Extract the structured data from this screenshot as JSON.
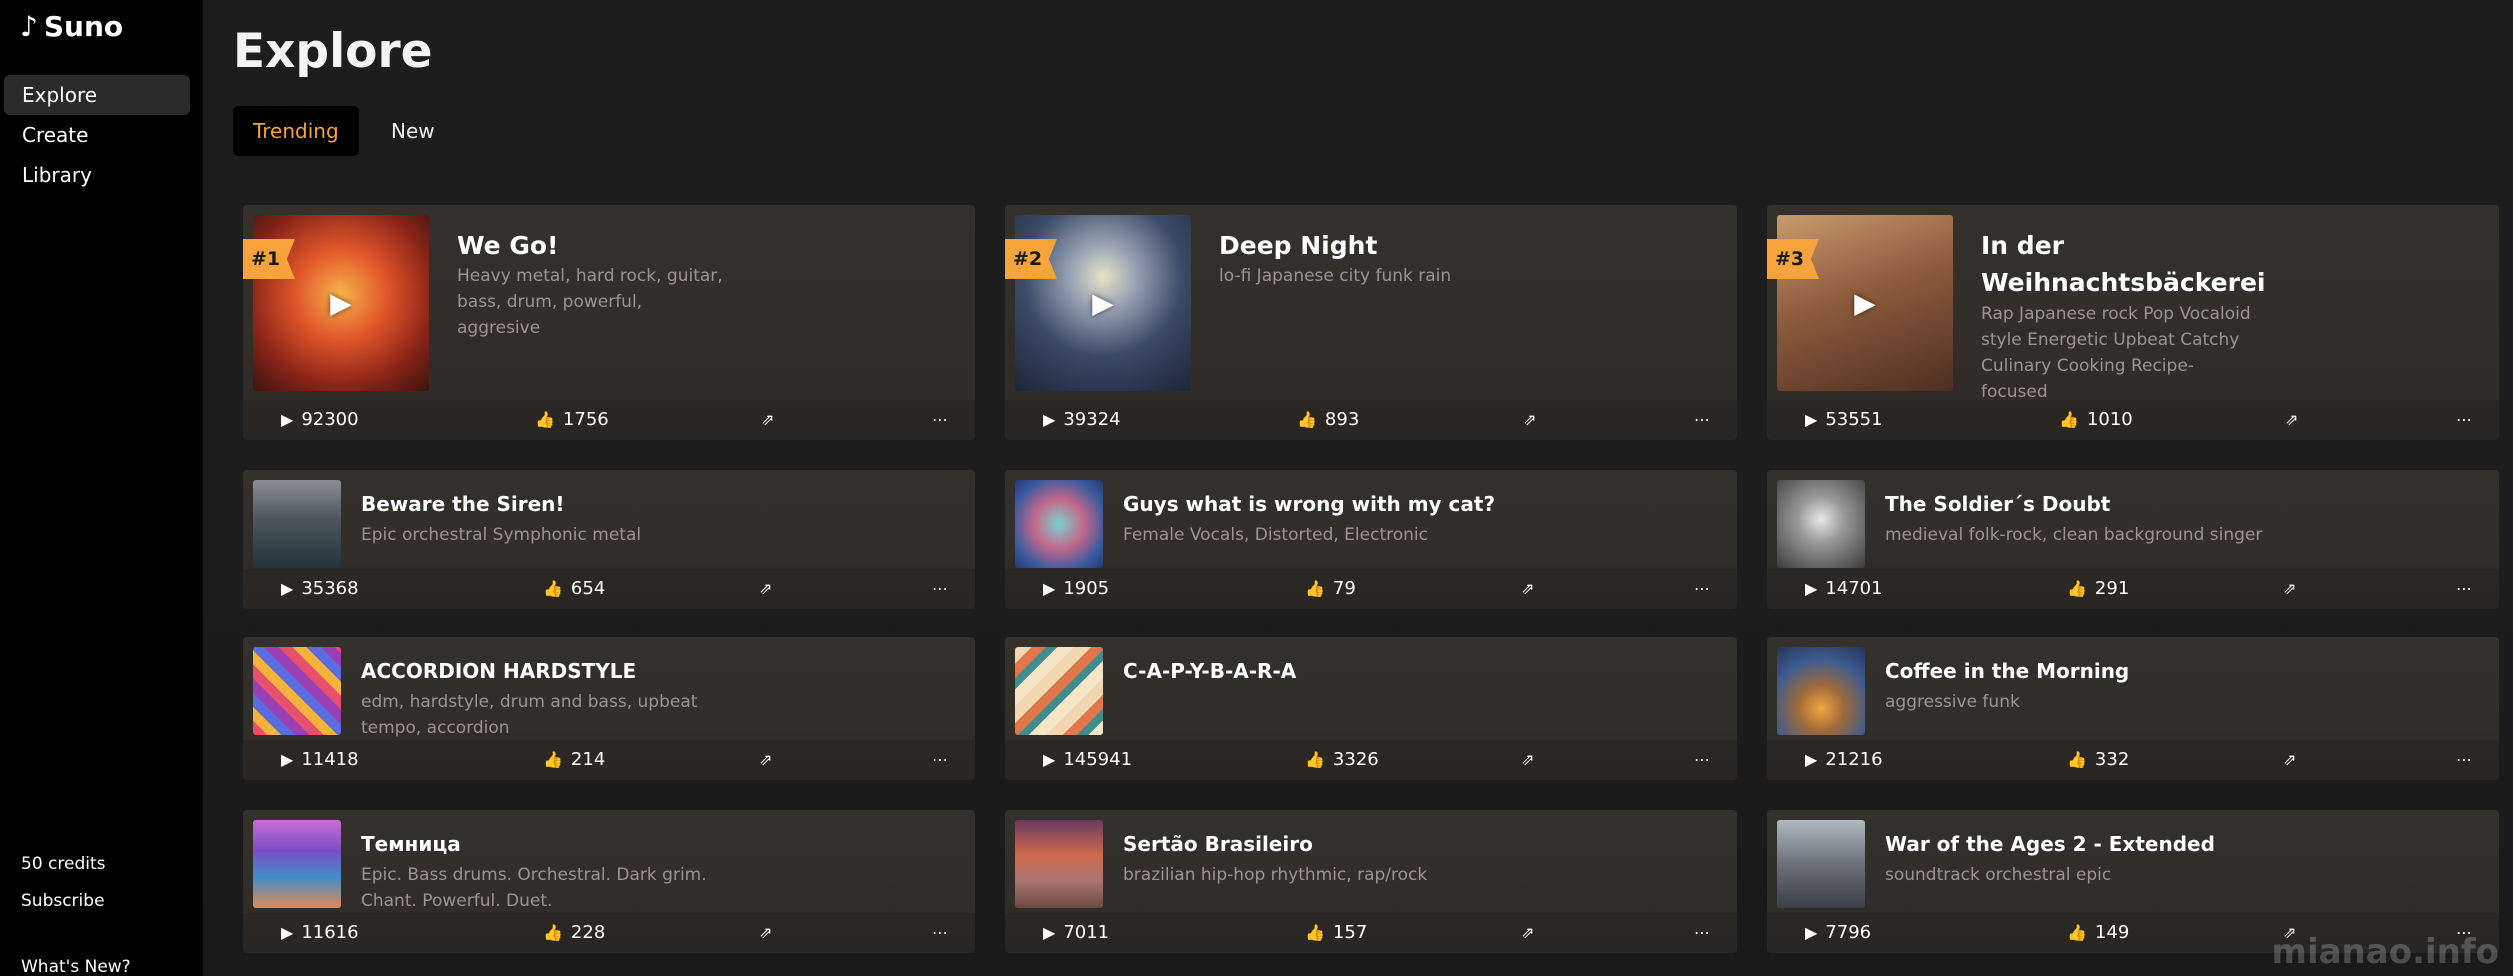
{
  "app": {
    "name": "Suno",
    "logo_glyph": "♪"
  },
  "sidebar": {
    "items": [
      {
        "label": "Explore",
        "active": true
      },
      {
        "label": "Create",
        "active": false
      },
      {
        "label": "Library",
        "active": false
      }
    ],
    "credits": "50 credits",
    "subscribe": "Subscribe",
    "whats_new": "What's New?"
  },
  "main": {
    "title": "Explore",
    "tabs": [
      {
        "label": "Trending",
        "active": true
      },
      {
        "label": "New",
        "active": false
      }
    ],
    "accent_color": "#f5a33a",
    "songs": [
      {
        "rank": "#1",
        "title": "We Go!",
        "tags": "Heavy metal, hard rock, guitar, bass, drum, powerful, aggresive",
        "plays": "92300",
        "likes": "1756",
        "art": "phoenix"
      },
      {
        "rank": "#2",
        "title": "Deep Night",
        "tags": "lo-fi Japanese city funk rain",
        "plays": "39324",
        "likes": "893",
        "art": "night-moon"
      },
      {
        "rank": "#3",
        "title": "In der Weihnachtsbäckerei",
        "tags": "Rap Japanese rock Pop Vocaloid style Energetic Upbeat Catchy Culinary Cooking Recipe-focused",
        "plays": "53551",
        "likes": "1010",
        "art": "bakery"
      },
      {
        "title": "Beware the Siren!",
        "tags": "Epic orchestral Symphonic metal",
        "plays": "35368",
        "likes": "654",
        "art": "ship"
      },
      {
        "title": "Guys what is wrong with my cat?",
        "tags": "Female Vocals, Distorted, Electronic",
        "plays": "1905",
        "likes": "79",
        "art": "cat"
      },
      {
        "title": "The Soldier´s Doubt",
        "tags": "medieval folk-rock, clean background singer",
        "plays": "14701",
        "likes": "291",
        "art": "prison-gate"
      },
      {
        "title": "ACCORDION HARDSTYLE",
        "tags": "edm, hardstyle, drum and bass, upbeat tempo, accordion",
        "plays": "11418",
        "likes": "214",
        "art": "pattern"
      },
      {
        "title": "C-A-P-Y-B-A-R-A",
        "tags": "",
        "plays": "145941",
        "likes": "3326",
        "art": "capybara"
      },
      {
        "title": "Coffee in the Morning",
        "tags": "aggressive funk",
        "plays": "21216",
        "likes": "332",
        "art": "coffee-city"
      },
      {
        "title": "Темница",
        "tags": "Epic. Bass drums. Orchestral. Dark grim. Chant. Powerful. Duet.",
        "plays": "11616",
        "likes": "228",
        "art": "landscape"
      },
      {
        "title": "Sertão Brasileiro",
        "tags": "brazilian hip-hop rhythmic, rap/rock",
        "plays": "7011",
        "likes": "157",
        "art": "sunset"
      },
      {
        "title": "War of the Ages 2 - Extended",
        "tags": "soundtrack orchestral epic",
        "plays": "7796",
        "likes": "149",
        "art": "mountain-dragon"
      }
    ]
  },
  "icons": {
    "play": "▶",
    "like": "👍",
    "share": "⇗",
    "more": "⋯"
  },
  "watermark": "mianao.info"
}
